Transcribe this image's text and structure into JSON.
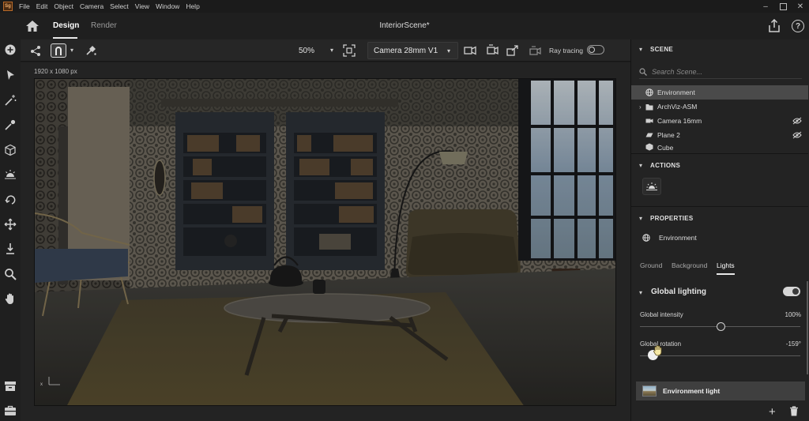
{
  "app": {
    "logo_text": "Sg",
    "menu": [
      "File",
      "Edit",
      "Object",
      "Camera",
      "Select",
      "View",
      "Window",
      "Help"
    ],
    "document_title": "InteriorScene*"
  },
  "header": {
    "tabs": [
      {
        "label": "Design",
        "active": true
      },
      {
        "label": "Render",
        "active": false
      }
    ]
  },
  "toolbar": {
    "zoom": "50%",
    "camera": "Camera 28mm V1",
    "ray_tracing_label": "Ray tracing",
    "ray_tracing_on": false
  },
  "canvas": {
    "size_label": "1920 x 1080 px"
  },
  "scene_panel": {
    "title": "SCENE",
    "search_placeholder": "Search Scene...",
    "items": [
      {
        "label": "Environment",
        "icon": "globe-icon",
        "selected": true
      },
      {
        "label": "ArchViz-ASM",
        "icon": "folder-icon",
        "expandable": true
      },
      {
        "label": "Camera 16mm",
        "icon": "camera-icon",
        "hidden": true
      },
      {
        "label": "Plane 2",
        "icon": "plane-icon",
        "hidden": true
      },
      {
        "label": "Cube",
        "icon": "cube-icon"
      }
    ]
  },
  "actions_panel": {
    "title": "ACTIONS"
  },
  "properties_panel": {
    "title": "PROPERTIES",
    "target": "Environment",
    "tabs": [
      {
        "label": "Ground",
        "active": false
      },
      {
        "label": "Background",
        "active": false
      },
      {
        "label": "Lights",
        "active": true
      }
    ],
    "global_lighting": {
      "title": "Global lighting",
      "enabled": true,
      "intensity_label": "Global intensity",
      "intensity_value": "100%",
      "intensity_fraction": 0.5,
      "rotation_label": "Global rotation",
      "rotation_value": "-159°",
      "rotation_fraction": 0.08
    },
    "light_item": "Environment light"
  },
  "colors": {
    "panel_bg": "#232323",
    "selected_row": "#4a4a4a",
    "accent": "#e8e8e8"
  }
}
